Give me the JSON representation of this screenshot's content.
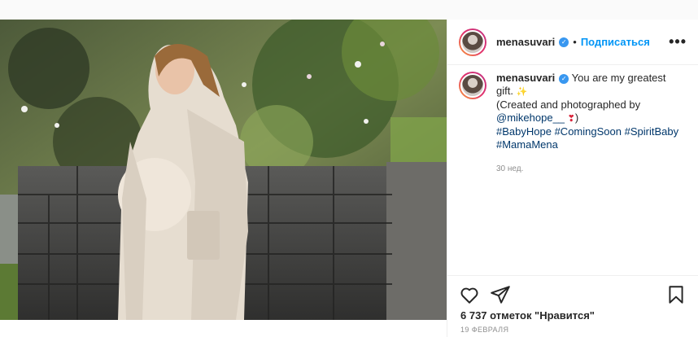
{
  "post": {
    "username": "menasuvari",
    "verified_icon": "verified-badge-icon",
    "dot": "•",
    "follow_label": "Подписаться",
    "more_label": "•••",
    "caption": {
      "line1": "You are my greatest",
      "line2": "gift.",
      "line3": "(Created and photographed by",
      "mention": "@mikehope__",
      "mention_tail": ")",
      "hashtags_line1": [
        "#BabyHope",
        "#ComingSoon",
        "#SpiritBaby"
      ],
      "hashtags_line2": [
        "#MamaMena"
      ]
    },
    "time_ago": "30 нед.",
    "likes": "6 737 отметок \"Нравится\"",
    "date": "19 ФЕВРАЛЯ"
  },
  "colors": {
    "accent": "#0095f6",
    "verified": "#3897f0",
    "text": "#262626",
    "muted": "#8e8e8e"
  }
}
